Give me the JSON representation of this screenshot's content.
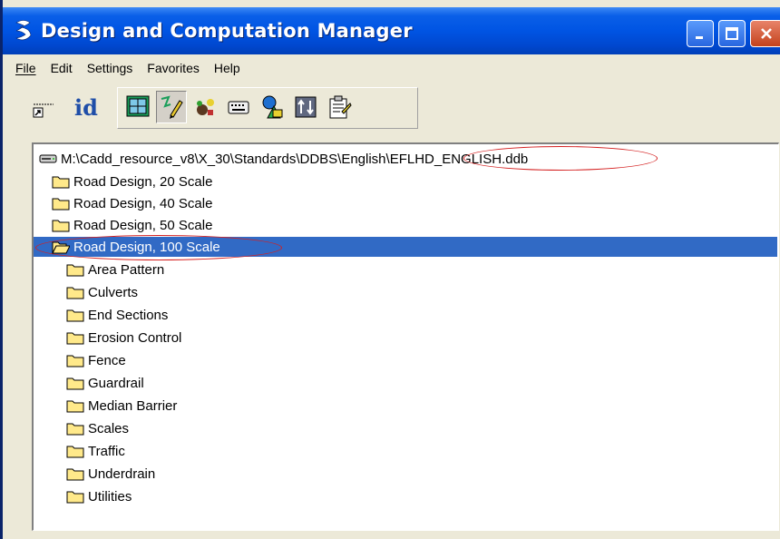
{
  "window": {
    "title": "Design and Computation Manager",
    "accent": "#0054e3",
    "selection_color": "#316ac5",
    "annotation_color": "#d42020"
  },
  "menu": {
    "items": [
      {
        "label": "File"
      },
      {
        "label": "Edit"
      },
      {
        "label": "Settings"
      },
      {
        "label": "Favorites"
      },
      {
        "label": "Help"
      }
    ]
  },
  "toolbar": {
    "id_label": "id",
    "icons": [
      "shortcut-icon",
      "id-icon",
      "grid-window-icon",
      "pencil-icon",
      "palette-icon",
      "keyboard-icon",
      "shapes-icon",
      "compute-icon",
      "properties-icon"
    ]
  },
  "tree": {
    "root_path": "M:\\Cadd_resource_v8\\X_30\\Standards\\DDBS\\English\\EFLHD_ENGLISH.ddb",
    "top_items": [
      {
        "label": "Road Design,  20 Scale"
      },
      {
        "label": "Road Design,  40 Scale"
      },
      {
        "label": "Road Design,  50 Scale"
      },
      {
        "label": "Road Design,  100 Scale",
        "selected": true,
        "expanded": true
      }
    ],
    "children": [
      {
        "label": "Area Pattern"
      },
      {
        "label": "Culverts"
      },
      {
        "label": "End Sections"
      },
      {
        "label": "Erosion Control"
      },
      {
        "label": "Fence"
      },
      {
        "label": "Guardrail"
      },
      {
        "label": "Median Barrier"
      },
      {
        "label": "Scales"
      },
      {
        "label": "Traffic"
      },
      {
        "label": "Underdrain"
      },
      {
        "label": "Utilities"
      }
    ]
  }
}
